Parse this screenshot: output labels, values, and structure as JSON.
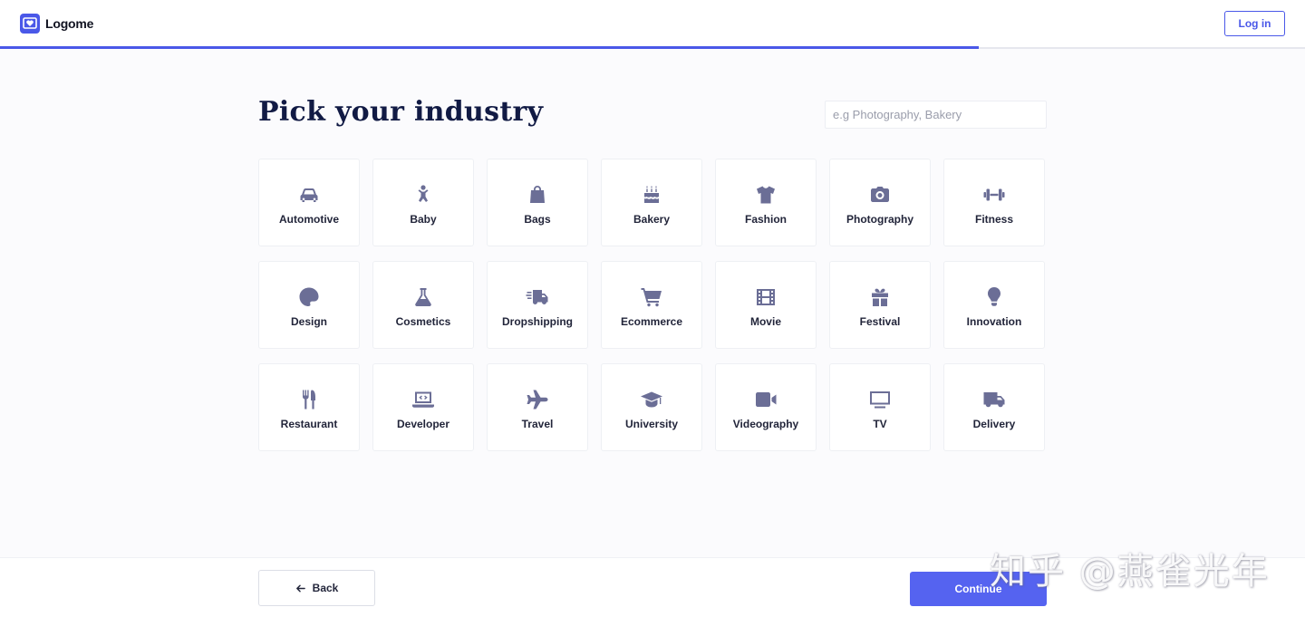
{
  "header": {
    "brand_name": "Logome",
    "login_label": "Log in",
    "progress_fraction": 0.75
  },
  "main": {
    "title": "Pick your industry",
    "search_placeholder": "e.g Photography, Bakery",
    "industries": [
      {
        "label": "Automotive",
        "icon": "car-icon"
      },
      {
        "label": "Baby",
        "icon": "baby-icon"
      },
      {
        "label": "Bags",
        "icon": "bag-icon"
      },
      {
        "label": "Bakery",
        "icon": "cake-icon"
      },
      {
        "label": "Fashion",
        "icon": "tshirt-icon"
      },
      {
        "label": "Photography",
        "icon": "camera-icon"
      },
      {
        "label": "Fitness",
        "icon": "dumbbell-icon"
      },
      {
        "label": "Design",
        "icon": "palette-icon"
      },
      {
        "label": "Cosmetics",
        "icon": "flask-icon"
      },
      {
        "label": "Dropshipping",
        "icon": "shipping-fast-icon"
      },
      {
        "label": "Ecommerce",
        "icon": "shopping-cart-icon"
      },
      {
        "label": "Movie",
        "icon": "film-icon"
      },
      {
        "label": "Festival",
        "icon": "gift-icon"
      },
      {
        "label": "Innovation",
        "icon": "lightbulb-icon"
      },
      {
        "label": "Restaurant",
        "icon": "utensils-icon"
      },
      {
        "label": "Developer",
        "icon": "laptop-code-icon"
      },
      {
        "label": "Travel",
        "icon": "plane-icon"
      },
      {
        "label": "University",
        "icon": "graduation-cap-icon"
      },
      {
        "label": "Videography",
        "icon": "video-camera-icon"
      },
      {
        "label": "TV",
        "icon": "tv-icon"
      },
      {
        "label": "Delivery",
        "icon": "truck-icon"
      }
    ]
  },
  "footer": {
    "back_label": "Back",
    "continue_label": "Continue"
  },
  "watermark": {
    "text": "知乎 @燕雀光年"
  },
  "colors": {
    "accent": "#4a58e8",
    "icon": "#6b6e96"
  }
}
